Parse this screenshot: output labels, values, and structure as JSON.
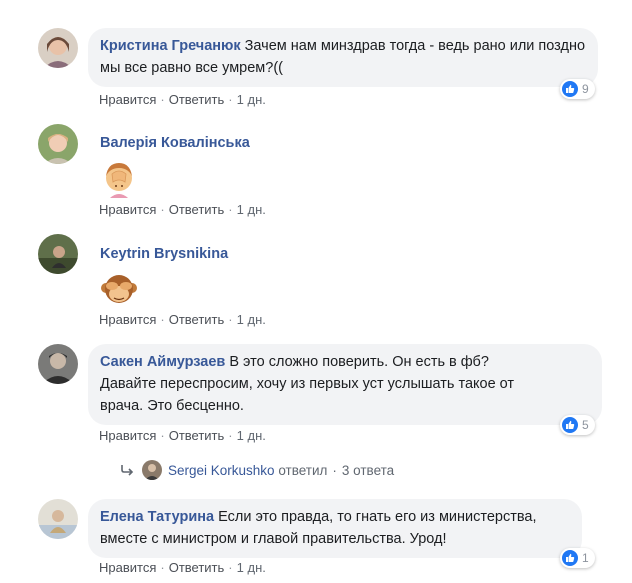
{
  "comments": [
    {
      "author": "Кристина Гречанюк",
      "text": "Зачем нам минздрав тогда - ведь рано или поздно мы все равно все умрем?((",
      "like": "Нравится",
      "reply": "Ответить",
      "time": "1 дн.",
      "reactions": "9"
    },
    {
      "author": "Валерія Ковалінська",
      "sticker": "facepalm-emoji",
      "like": "Нравится",
      "reply": "Ответить",
      "time": "1 дн."
    },
    {
      "author": "Keytrin Brysnikina",
      "sticker": "see-no-evil-monkey-emoji",
      "like": "Нравится",
      "reply": "Ответить",
      "time": "1 дн."
    },
    {
      "author": "Сакен Аймурзаев",
      "text_lines": [
        "В это сложно поверить. Он есть в фб?",
        "Давайте переспросим, хочу из первых уст услышать такое от",
        "врача. Это бесценно."
      ],
      "like": "Нравится",
      "reply": "Ответить",
      "time": "1 дн.",
      "reactions": "5",
      "replies": {
        "author": "Sergei Korkushko",
        "action": "ответил",
        "count": "3 ответа"
      }
    },
    {
      "author": "Елена Татурина",
      "text_lines": [
        "Если это правда, то гнать его из министерства,",
        "вместе с министром и главой правительства. Урод!"
      ],
      "like": "Нравится",
      "reply": "Ответить",
      "time": "1 дн.",
      "reactions": "1"
    }
  ],
  "colors": {
    "link": "#385898",
    "bubble": "#f2f3f5",
    "like_blue": "#2078f4",
    "meta": "#606770"
  }
}
